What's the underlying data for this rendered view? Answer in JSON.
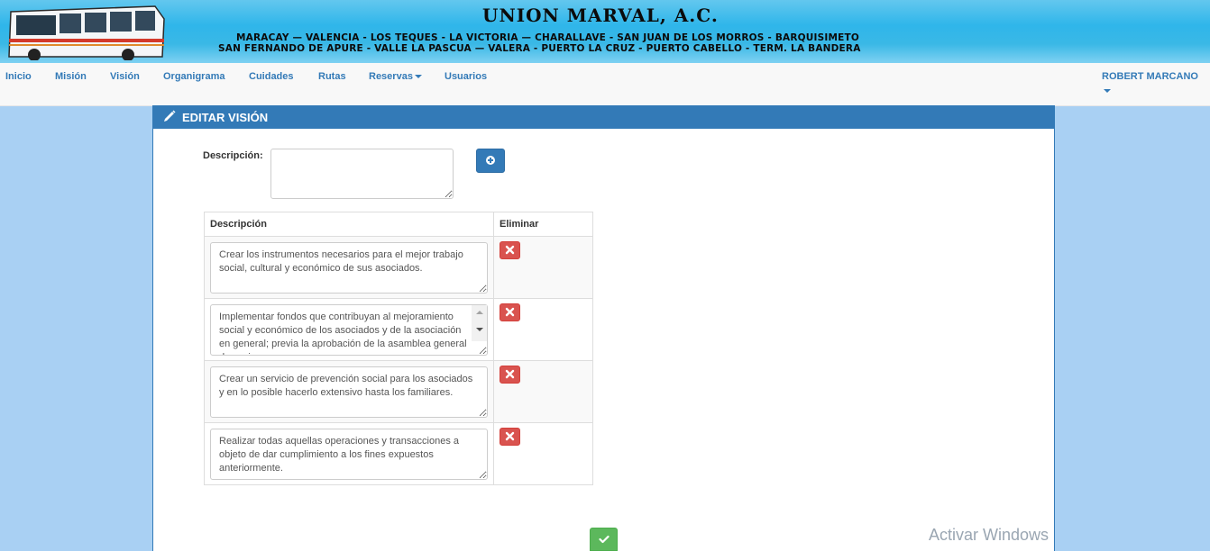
{
  "banner": {
    "title": "UNION MARVAL, A.C.",
    "routes_line1": "MARACAY — VALENCIA - LOS TEQUES - LA VICTORIA — CHARALLAVE - SAN JUAN DE LOS MORROS - BARQUISIMETO",
    "routes_line2": "SAN FERNANDO DE APURE - VALLE  LA PASCUA — VALERA - PUERTO LA CRUZ - PUERTO CABELLO - TERM. LA BANDERA"
  },
  "nav": {
    "items": [
      {
        "label": "Inicio"
      },
      {
        "label": "Misión"
      },
      {
        "label": "Visión"
      },
      {
        "label": "Organigrama"
      },
      {
        "label": "Cuidades"
      },
      {
        "label": "Rutas"
      },
      {
        "label": "Reservas"
      },
      {
        "label": "Usuarios"
      }
    ],
    "user": "ROBERT MARCANO"
  },
  "panel": {
    "title": "EDITAR VISIÓN",
    "description_label": "Descripción:",
    "description_value": "",
    "table": {
      "headers": [
        "Descripción",
        "Eliminar"
      ],
      "rows": [
        {
          "text": "Crear los instrumentos necesarios para el mejor trabajo social, cultural y económico de sus asociados."
        },
        {
          "text": "Implementar fondos que contribuyan al mejoramiento social y económico de los asociados y de la asociación en general; previa la aprobación de la asamblea general de socios."
        },
        {
          "text": "Crear un servicio de prevención social para los asociados y en lo posible hacerlo extensivo hasta los familiares."
        },
        {
          "text": "Realizar todas aquellas operaciones y transacciones a objeto de dar cumplimiento a los fines expuestos anteriormente."
        }
      ]
    }
  },
  "watermark": "Activar Windows",
  "colors": {
    "primary": "#337ab7",
    "danger": "#d9534f",
    "success": "#5cb85c",
    "page_bg": "#a9d0f3"
  }
}
